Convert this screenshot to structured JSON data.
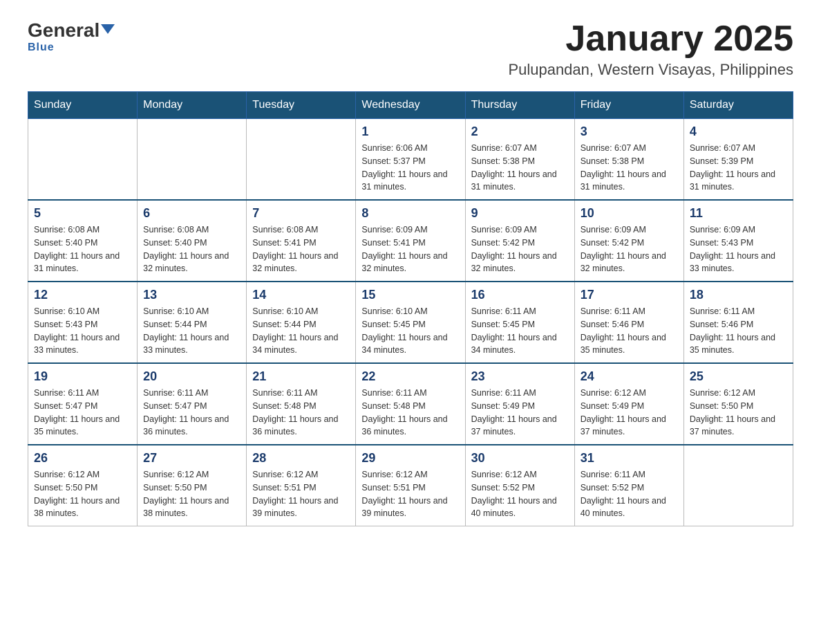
{
  "header": {
    "logo_general": "General",
    "logo_blue": "Blue",
    "month_title": "January 2025",
    "location": "Pulupandan, Western Visayas, Philippines"
  },
  "days_of_week": [
    "Sunday",
    "Monday",
    "Tuesday",
    "Wednesday",
    "Thursday",
    "Friday",
    "Saturday"
  ],
  "weeks": [
    [
      {
        "day": "",
        "info": ""
      },
      {
        "day": "",
        "info": ""
      },
      {
        "day": "",
        "info": ""
      },
      {
        "day": "1",
        "info": "Sunrise: 6:06 AM\nSunset: 5:37 PM\nDaylight: 11 hours and 31 minutes."
      },
      {
        "day": "2",
        "info": "Sunrise: 6:07 AM\nSunset: 5:38 PM\nDaylight: 11 hours and 31 minutes."
      },
      {
        "day": "3",
        "info": "Sunrise: 6:07 AM\nSunset: 5:38 PM\nDaylight: 11 hours and 31 minutes."
      },
      {
        "day": "4",
        "info": "Sunrise: 6:07 AM\nSunset: 5:39 PM\nDaylight: 11 hours and 31 minutes."
      }
    ],
    [
      {
        "day": "5",
        "info": "Sunrise: 6:08 AM\nSunset: 5:40 PM\nDaylight: 11 hours and 31 minutes."
      },
      {
        "day": "6",
        "info": "Sunrise: 6:08 AM\nSunset: 5:40 PM\nDaylight: 11 hours and 32 minutes."
      },
      {
        "day": "7",
        "info": "Sunrise: 6:08 AM\nSunset: 5:41 PM\nDaylight: 11 hours and 32 minutes."
      },
      {
        "day": "8",
        "info": "Sunrise: 6:09 AM\nSunset: 5:41 PM\nDaylight: 11 hours and 32 minutes."
      },
      {
        "day": "9",
        "info": "Sunrise: 6:09 AM\nSunset: 5:42 PM\nDaylight: 11 hours and 32 minutes."
      },
      {
        "day": "10",
        "info": "Sunrise: 6:09 AM\nSunset: 5:42 PM\nDaylight: 11 hours and 32 minutes."
      },
      {
        "day": "11",
        "info": "Sunrise: 6:09 AM\nSunset: 5:43 PM\nDaylight: 11 hours and 33 minutes."
      }
    ],
    [
      {
        "day": "12",
        "info": "Sunrise: 6:10 AM\nSunset: 5:43 PM\nDaylight: 11 hours and 33 minutes."
      },
      {
        "day": "13",
        "info": "Sunrise: 6:10 AM\nSunset: 5:44 PM\nDaylight: 11 hours and 33 minutes."
      },
      {
        "day": "14",
        "info": "Sunrise: 6:10 AM\nSunset: 5:44 PM\nDaylight: 11 hours and 34 minutes."
      },
      {
        "day": "15",
        "info": "Sunrise: 6:10 AM\nSunset: 5:45 PM\nDaylight: 11 hours and 34 minutes."
      },
      {
        "day": "16",
        "info": "Sunrise: 6:11 AM\nSunset: 5:45 PM\nDaylight: 11 hours and 34 minutes."
      },
      {
        "day": "17",
        "info": "Sunrise: 6:11 AM\nSunset: 5:46 PM\nDaylight: 11 hours and 35 minutes."
      },
      {
        "day": "18",
        "info": "Sunrise: 6:11 AM\nSunset: 5:46 PM\nDaylight: 11 hours and 35 minutes."
      }
    ],
    [
      {
        "day": "19",
        "info": "Sunrise: 6:11 AM\nSunset: 5:47 PM\nDaylight: 11 hours and 35 minutes."
      },
      {
        "day": "20",
        "info": "Sunrise: 6:11 AM\nSunset: 5:47 PM\nDaylight: 11 hours and 36 minutes."
      },
      {
        "day": "21",
        "info": "Sunrise: 6:11 AM\nSunset: 5:48 PM\nDaylight: 11 hours and 36 minutes."
      },
      {
        "day": "22",
        "info": "Sunrise: 6:11 AM\nSunset: 5:48 PM\nDaylight: 11 hours and 36 minutes."
      },
      {
        "day": "23",
        "info": "Sunrise: 6:11 AM\nSunset: 5:49 PM\nDaylight: 11 hours and 37 minutes."
      },
      {
        "day": "24",
        "info": "Sunrise: 6:12 AM\nSunset: 5:49 PM\nDaylight: 11 hours and 37 minutes."
      },
      {
        "day": "25",
        "info": "Sunrise: 6:12 AM\nSunset: 5:50 PM\nDaylight: 11 hours and 37 minutes."
      }
    ],
    [
      {
        "day": "26",
        "info": "Sunrise: 6:12 AM\nSunset: 5:50 PM\nDaylight: 11 hours and 38 minutes."
      },
      {
        "day": "27",
        "info": "Sunrise: 6:12 AM\nSunset: 5:50 PM\nDaylight: 11 hours and 38 minutes."
      },
      {
        "day": "28",
        "info": "Sunrise: 6:12 AM\nSunset: 5:51 PM\nDaylight: 11 hours and 39 minutes."
      },
      {
        "day": "29",
        "info": "Sunrise: 6:12 AM\nSunset: 5:51 PM\nDaylight: 11 hours and 39 minutes."
      },
      {
        "day": "30",
        "info": "Sunrise: 6:12 AM\nSunset: 5:52 PM\nDaylight: 11 hours and 40 minutes."
      },
      {
        "day": "31",
        "info": "Sunrise: 6:11 AM\nSunset: 5:52 PM\nDaylight: 11 hours and 40 minutes."
      },
      {
        "day": "",
        "info": ""
      }
    ]
  ]
}
